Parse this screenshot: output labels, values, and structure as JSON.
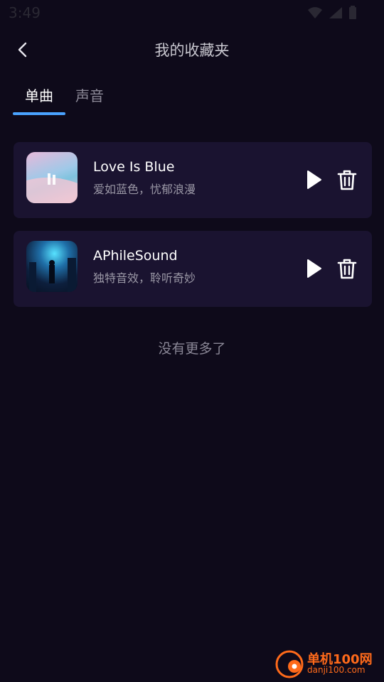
{
  "status_bar": {
    "time": "3:49"
  },
  "header": {
    "title": "我的收藏夹"
  },
  "tabs": [
    {
      "label": "单曲",
      "active": true
    },
    {
      "label": "声音",
      "active": false
    }
  ],
  "songs": [
    {
      "title": "Love Is Blue",
      "subtitle": "爱如蓝色，忧郁浪漫"
    },
    {
      "title": "APhileSound",
      "subtitle": "独特音效，聆听奇妙"
    }
  ],
  "footer_text": "没有更多了",
  "watermark": {
    "name": "单机100网",
    "url": "danji100.com"
  },
  "colors": {
    "background": "#0e0a1a",
    "card": "#1a1330",
    "tab_indicator": "#4aa3ff",
    "watermark": "#ff6a1a"
  }
}
